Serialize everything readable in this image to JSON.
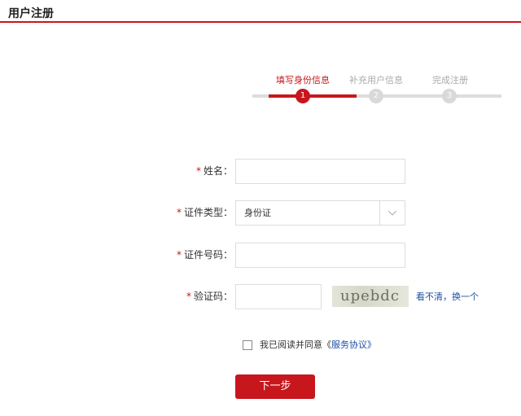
{
  "header": {
    "title": "用户注册"
  },
  "steps": [
    {
      "label": "填写身份信息",
      "number": "1",
      "active": true
    },
    {
      "label": "补充用户信息",
      "number": "2",
      "active": false
    },
    {
      "label": "完成注册",
      "number": "3",
      "active": false
    }
  ],
  "form": {
    "required_mark": "*",
    "name": {
      "label": "姓名：",
      "value": ""
    },
    "id_type": {
      "label": "证件类型：",
      "selected": "身份证"
    },
    "id_number": {
      "label": "证件号码：",
      "value": ""
    },
    "captcha": {
      "label": "验证码：",
      "value": "",
      "image_text": "upebdc",
      "refresh_label": "看不清，换一个"
    }
  },
  "agreement": {
    "text": "我已阅读并同意《",
    "link": "服务协议",
    "close": "》",
    "checked": false
  },
  "next_button": {
    "label": "下一步"
  },
  "colors": {
    "accent": "#c8161d",
    "link": "#1d4fa5"
  }
}
